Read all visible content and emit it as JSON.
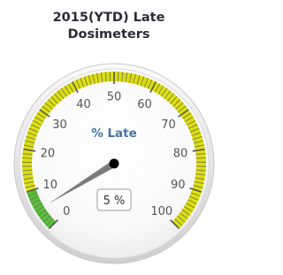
{
  "chart_data": {
    "type": "gauge",
    "title": "2015(YTD) Late Dosimeters",
    "title_lines": [
      "2015(YTD) Late",
      "Dosimeters"
    ],
    "gauge_label": "% Late",
    "value": 5,
    "value_display": "5 %",
    "min": 0,
    "max": 100,
    "tick_labels": [
      "0",
      "10",
      "20",
      "30",
      "40",
      "50",
      "60",
      "70",
      "80",
      "90",
      "100"
    ],
    "bands": [
      {
        "from": 0,
        "to": 10,
        "color": "#55bf3b"
      },
      {
        "from": 10,
        "to": 100,
        "color": "#dddf0d"
      }
    ],
    "colors": {
      "band_green": "#55bf3b",
      "band_yellow": "#dddf0d",
      "label": "#4572a7",
      "needle": "#7b7b7b",
      "pivot": "#000000"
    }
  }
}
